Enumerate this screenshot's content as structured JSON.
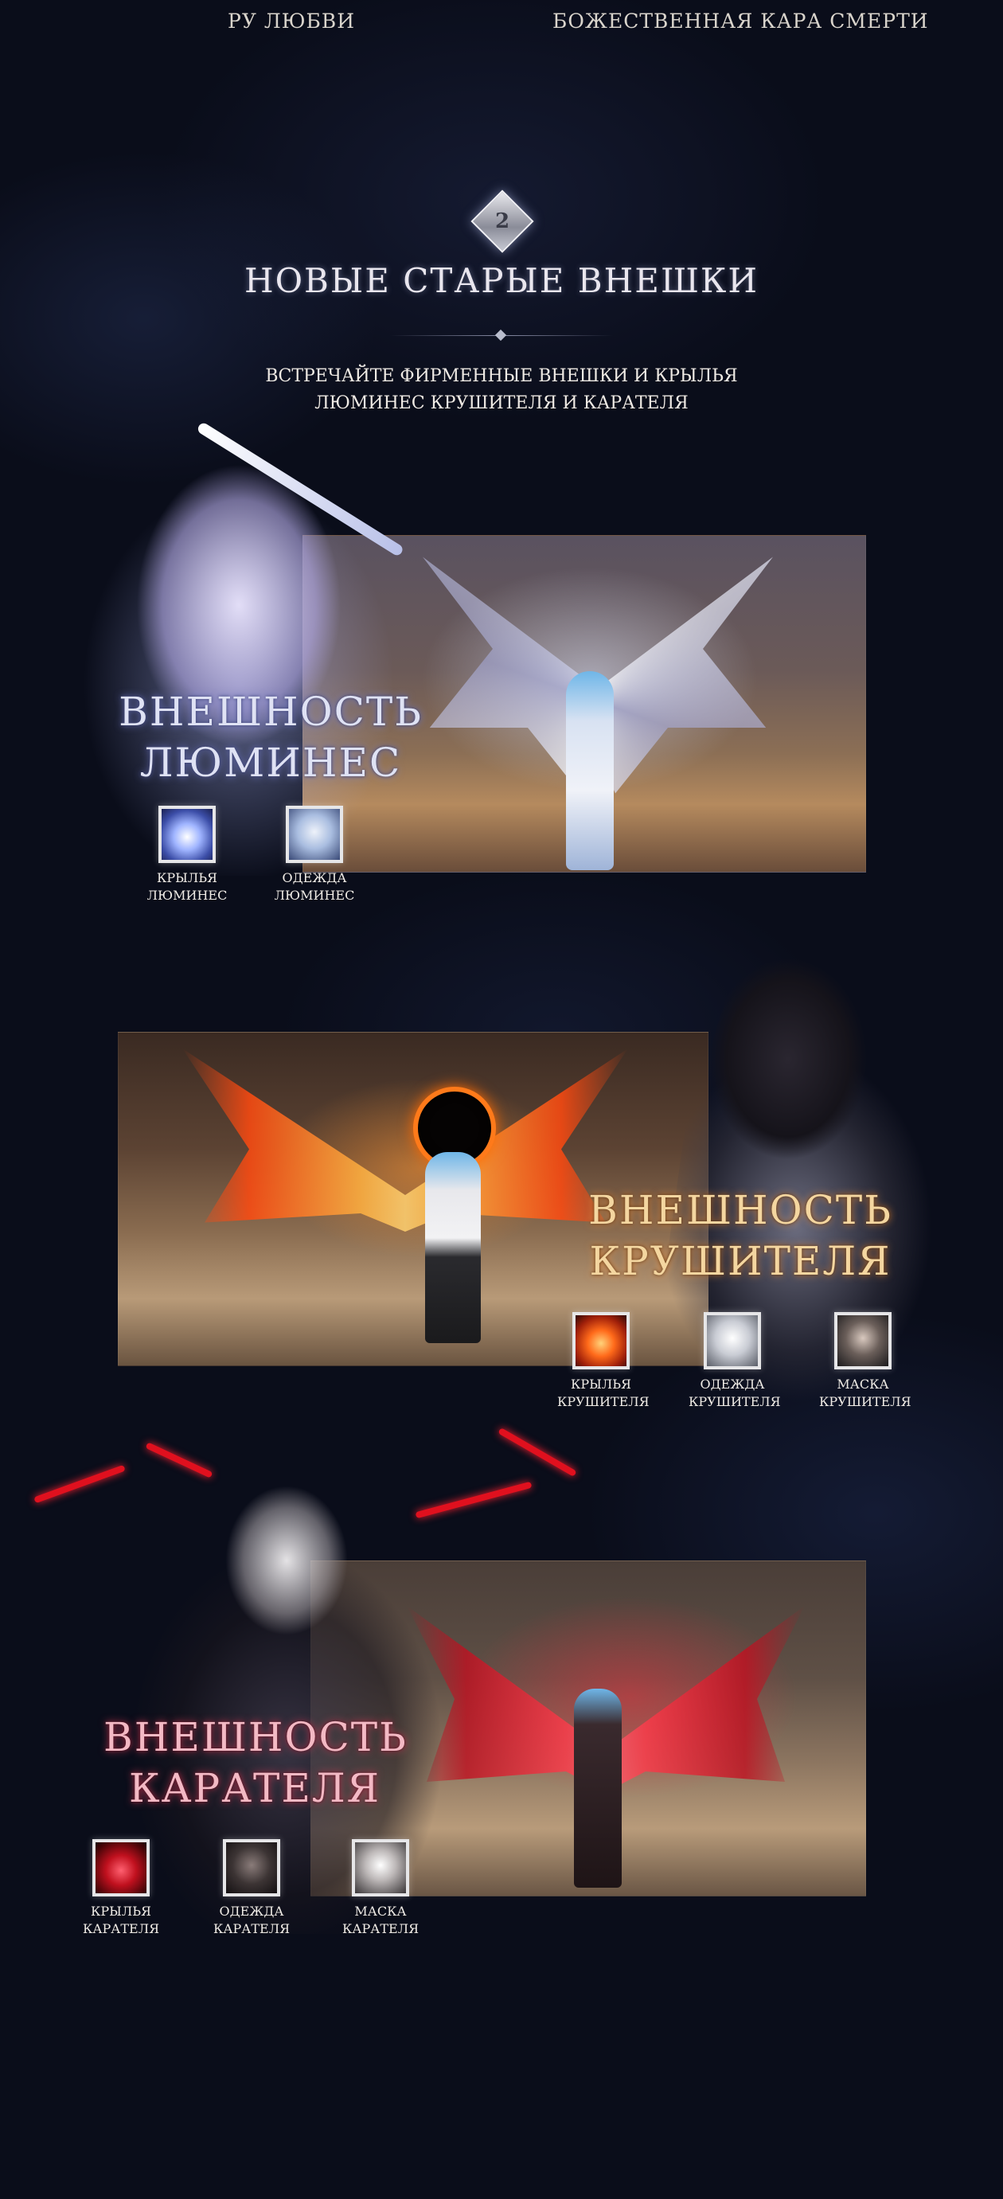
{
  "nav": {
    "left": "РУ ЛЮБВИ",
    "right": "БОЖЕСТВЕННАЯ КАРА СМЕРТИ"
  },
  "section": {
    "number": "2",
    "title": "НОВЫЕ СТАРЫЕ ВНЕШКИ",
    "subtitle_line1": "ВСТРЕЧАЙТЕ ФИРМЕННЫЕ ВНЕШКИ И КРЫЛЬЯ",
    "subtitle_line2": "ЛЮМИНЕС КРУШИТЕЛЯ И КАРАТЕЛЯ"
  },
  "lumines": {
    "title_line1": "ВНЕШНОСТЬ",
    "title_line2": "ЛЮМИНЕС",
    "items": [
      {
        "label1": "КРЫЛЬЯ",
        "label2": "ЛЮМИНЕС",
        "icon": "lumines-wings-icon"
      },
      {
        "label1": "ОДЕЖДА",
        "label2": "ЛЮМИНЕС",
        "icon": "lumines-outfit-icon"
      }
    ]
  },
  "krushitel": {
    "title_line1": "ВНЕШНОСТЬ",
    "title_line2": "КРУШИТЕЛЯ",
    "items": [
      {
        "label1": "КРЫЛЬЯ",
        "label2": "КРУШИТЕЛЯ",
        "icon": "krushitel-wings-icon"
      },
      {
        "label1": "ОДЕЖДА",
        "label2": "КРУШИТЕЛЯ",
        "icon": "krushitel-outfit-icon"
      },
      {
        "label1": "МАСКА",
        "label2": "КРУШИТЕЛЯ",
        "icon": "krushitel-mask-icon"
      }
    ]
  },
  "karatel": {
    "title_line1": "ВНЕШНОСТЬ",
    "title_line2": "КАРАТЕЛЯ",
    "items": [
      {
        "label1": "КРЫЛЬЯ",
        "label2": "КАРАТЕЛЯ",
        "icon": "karatel-wings-icon"
      },
      {
        "label1": "ОДЕЖДА",
        "label2": "КАРАТЕЛЯ",
        "icon": "karatel-outfit-icon"
      },
      {
        "label1": "МАСКА",
        "label2": "КАРАТЕЛЯ",
        "icon": "karatel-mask-icon"
      }
    ]
  },
  "colors": {
    "background": "#0a0d1a",
    "lumines_accent": "#dfe2f4",
    "krushitel_accent": "#f4d6a0",
    "karatel_accent": "#f3b9c4"
  }
}
